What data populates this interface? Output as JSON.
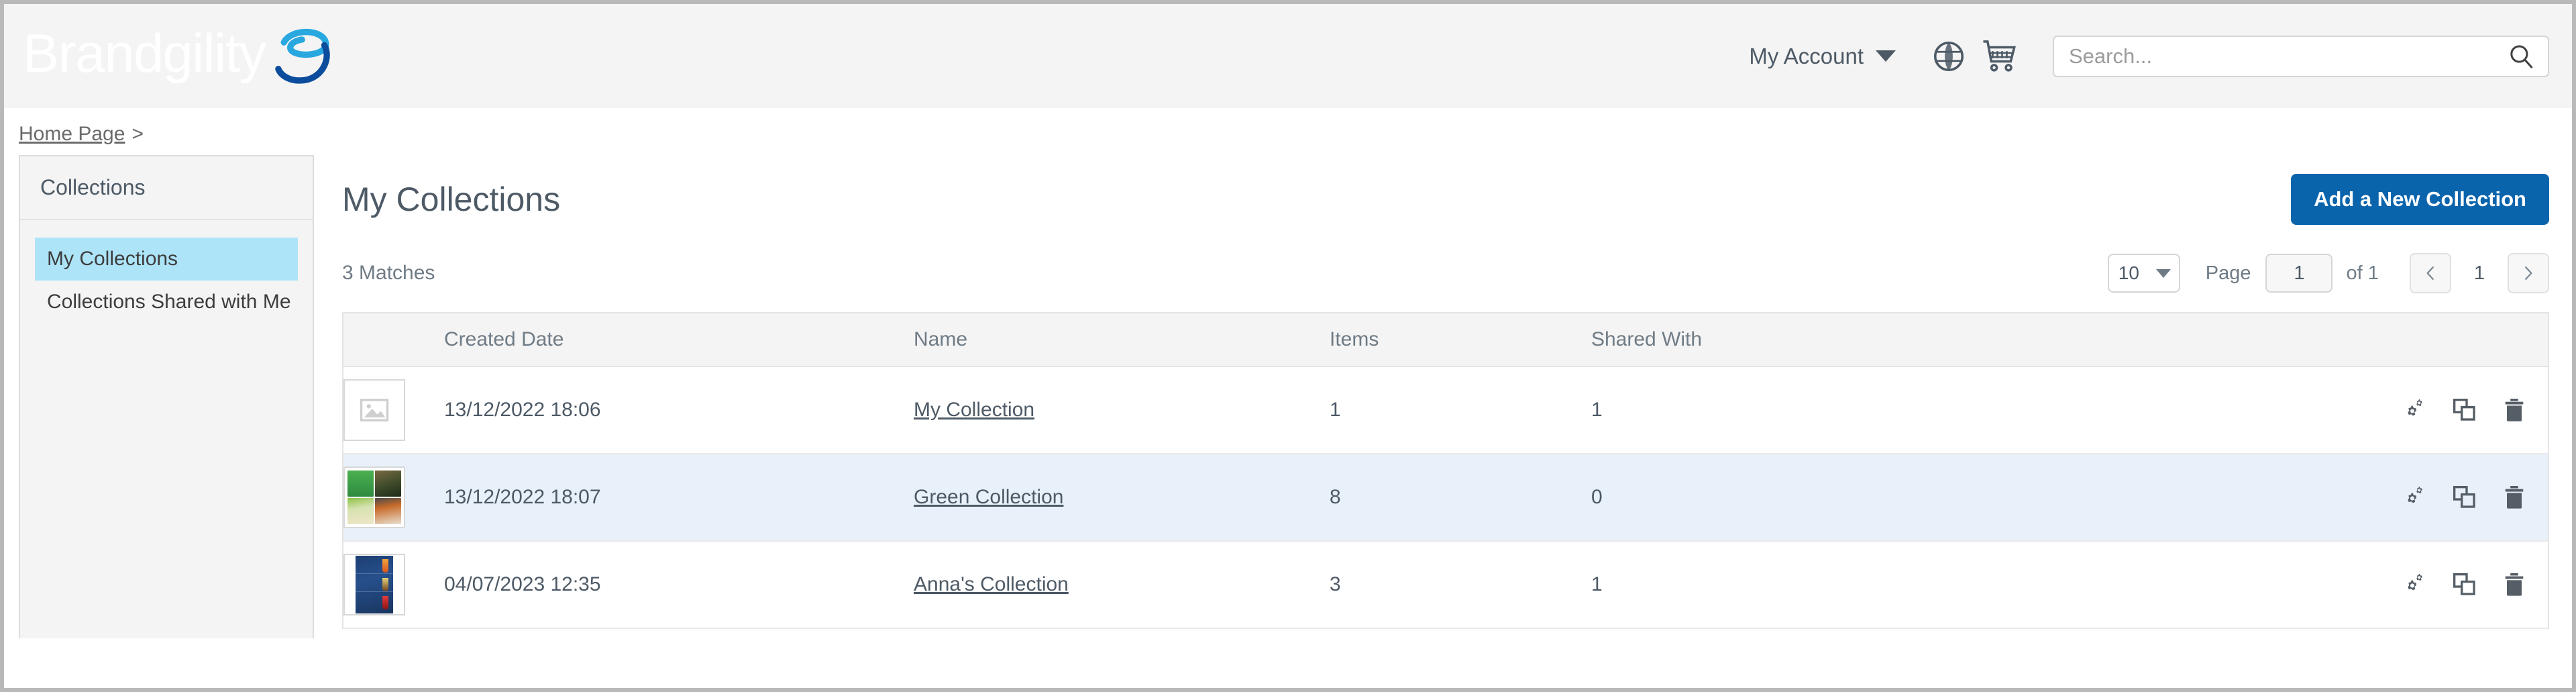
{
  "header": {
    "logo_text": "Brandgility",
    "logo_icon": "swirl-logo-icon",
    "account_label": "My Account",
    "caret_icon": "chevron-down-icon",
    "globe_icon": "globe-icon",
    "cart_icon": "shopping-cart-icon",
    "search": {
      "placeholder": "Search...",
      "value": "",
      "icon": "search-icon"
    },
    "background_color": "#f4f4f4",
    "logo_color": "#ffffff",
    "logo_accent_light": "#29a8e0",
    "logo_accent_dark": "#0b4d9c"
  },
  "breadcrumb": {
    "home_label": "Home Page",
    "separator": ">"
  },
  "sidebar": {
    "title": "Collections",
    "items": [
      {
        "label": "My Collections",
        "active": true
      },
      {
        "label": "Collections Shared with Me",
        "active": false
      }
    ],
    "active_color": "#ade4f8"
  },
  "main": {
    "page_title": "My Collections",
    "add_button_label": "Add a New Collection",
    "add_button_color": "#0a64ac",
    "matches_label": "3 Matches",
    "pagination": {
      "per_page_value": "10",
      "per_page_caret_icon": "chevron-down-icon",
      "page_label": "Page",
      "page_value": "1",
      "of_label": "of 1",
      "prev_icon": "chevron-left-icon",
      "next_icon": "chevron-right-icon",
      "current_page_number": "1"
    },
    "table": {
      "columns": [
        "",
        "Created Date",
        "Name",
        "Items",
        "Shared With",
        ""
      ],
      "row_action_icons": [
        "settings-gears-icon",
        "duplicate-icon",
        "delete-trash-icon"
      ],
      "rows": [
        {
          "thumbnail": "image-placeholder-icon",
          "created_date": "13/12/2022 18:06",
          "name": "My Collection",
          "items": "1",
          "shared_with": "1",
          "highlighted": false
        },
        {
          "thumbnail": "green-collage-thumbnail",
          "created_date": "13/12/2022 18:07",
          "name": "Green Collection",
          "items": "8",
          "shared_with": "0",
          "highlighted": true
        },
        {
          "thumbnail": "blue-cocktail-poster-thumbnail",
          "created_date": "04/07/2023 12:35",
          "name": "Anna's Collection",
          "items": "3",
          "shared_with": "1",
          "highlighted": false
        }
      ]
    }
  }
}
